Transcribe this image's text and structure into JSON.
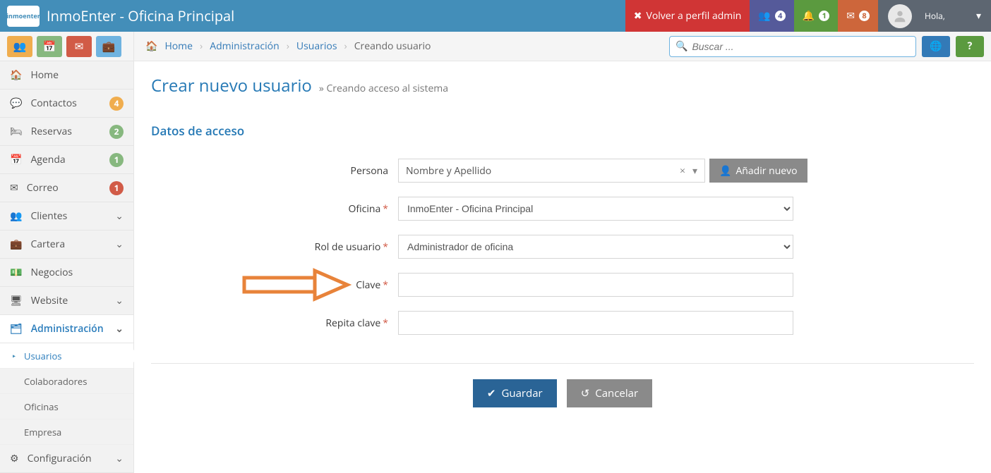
{
  "header": {
    "brand": "InmoEnter - Oficina Principal",
    "logo_text": "inmoenter",
    "back_admin": "Volver a perfil admin",
    "badges": {
      "users": "4",
      "bell": "1",
      "mail": "8"
    },
    "user_greet": "Hola,",
    "user_name": ""
  },
  "breadcrumb": {
    "home": "Home",
    "admin": "Administración",
    "users": "Usuarios",
    "current": "Creando usuario"
  },
  "search": {
    "placeholder": "Buscar ..."
  },
  "sidebar": {
    "items": [
      {
        "icon": "home",
        "label": "Home"
      },
      {
        "icon": "chat",
        "label": "Contactos",
        "badge": "4",
        "badgeClass": "b-orange"
      },
      {
        "icon": "bed",
        "label": "Reservas",
        "badge": "2",
        "badgeClass": "b-green"
      },
      {
        "icon": "cal",
        "label": "Agenda",
        "badge": "1",
        "badgeClass": "b-green"
      },
      {
        "icon": "mail",
        "label": "Correo",
        "badge": "1",
        "badgeClass": "b-red"
      },
      {
        "icon": "users",
        "label": "Clientes",
        "chev": true
      },
      {
        "icon": "case",
        "label": "Cartera",
        "chev": true
      },
      {
        "icon": "cash",
        "label": "Negocios"
      },
      {
        "icon": "screen",
        "label": "Website",
        "chev": true
      },
      {
        "icon": "tree",
        "label": "Administración",
        "chev": true,
        "active": true
      },
      {
        "icon": "gear",
        "label": "Configuración",
        "chev": true
      }
    ],
    "admin_children": [
      {
        "label": "Usuarios",
        "active": true
      },
      {
        "label": "Colaboradores"
      },
      {
        "label": "Oficinas"
      },
      {
        "label": "Empresa"
      }
    ]
  },
  "page": {
    "title": "Crear nuevo usuario",
    "subtitle": "» Creando acceso al sistema",
    "section": "Datos de acceso"
  },
  "form": {
    "persona_label": "Persona",
    "persona_value": "Nombre y Apellido",
    "addnew": "Añadir nuevo",
    "oficina_label": "Oficina",
    "oficina_value": "InmoEnter - Oficina Principal",
    "rol_label": "Rol de usuario",
    "rol_value": "Administrador de oficina",
    "clave_label": "Clave",
    "repita_label": "Repita clave",
    "guardar": "Guardar",
    "cancelar": "Cancelar"
  }
}
